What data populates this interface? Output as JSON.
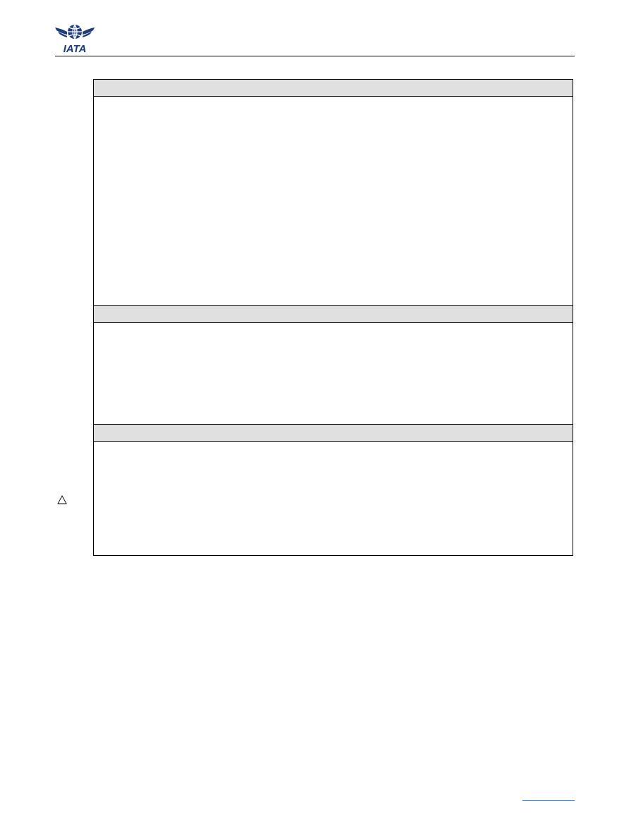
{
  "header": {
    "logo_text": "IATA",
    "logo_icon": "iata-globe-wings-icon",
    "brand_color": "#1f3d7a"
  },
  "table": {
    "sections": [
      {
        "header_text": "",
        "body_text": ""
      },
      {
        "header_text": "",
        "body_text": ""
      },
      {
        "header_text": "",
        "body_text": ""
      }
    ]
  },
  "margin_marker": {
    "icon": "change-triangle-icon"
  },
  "footer": {
    "link_text": "",
    "link_color": "#1a73e8"
  }
}
